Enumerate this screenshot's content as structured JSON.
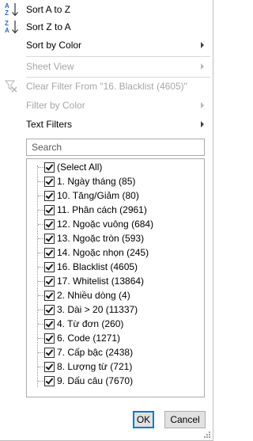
{
  "menu": {
    "sort_asc": "Sort A to Z",
    "sort_desc": "Sort Z to A",
    "sort_by_color": "Sort by Color",
    "sheet_view": "Sheet View",
    "clear_filter": "Clear Filter From \"16. Blacklist (4605)\"",
    "filter_by_color": "Filter by Color",
    "text_filters": "Text Filters"
  },
  "search": {
    "placeholder": "Search"
  },
  "filter_list": {
    "items": [
      {
        "label": "(Select All)",
        "checked": true
      },
      {
        "label": "1. Ngày tháng (85)",
        "checked": true
      },
      {
        "label": "10. Tăng/Giảm (80)",
        "checked": true
      },
      {
        "label": "11. Phân cách (2961)",
        "checked": true
      },
      {
        "label": "12. Ngoặc vuông (684)",
        "checked": true
      },
      {
        "label": "13. Ngoặc tròn (593)",
        "checked": true
      },
      {
        "label": "14. Ngoặc nhọn (245)",
        "checked": true
      },
      {
        "label": "16. Blacklist (4605)",
        "checked": true
      },
      {
        "label": "17. Whitelist (13864)",
        "checked": true
      },
      {
        "label": "2. Nhiều dòng (4)",
        "checked": true
      },
      {
        "label": "3. Dài > 20 (11337)",
        "checked": true
      },
      {
        "label": "4. Từ đơn (260)",
        "checked": true
      },
      {
        "label": "6. Code (1271)",
        "checked": true
      },
      {
        "label": "7. Cấp bậc (2438)",
        "checked": true
      },
      {
        "label": "8. Lượng từ (721)",
        "checked": true
      },
      {
        "label": "9. Dấu câu (7670)",
        "checked": true
      }
    ]
  },
  "buttons": {
    "ok": "OK",
    "cancel": "Cancel"
  },
  "icons": {
    "sort_asc": "sort-a-to-z-icon",
    "sort_desc": "sort-z-to-a-icon",
    "clear_filter": "clear-filter-icon"
  },
  "colors": {
    "accent": "#0078d7",
    "disabled_text": "#a6a6a6",
    "sort_icon_blue": "#2b6cc4"
  }
}
